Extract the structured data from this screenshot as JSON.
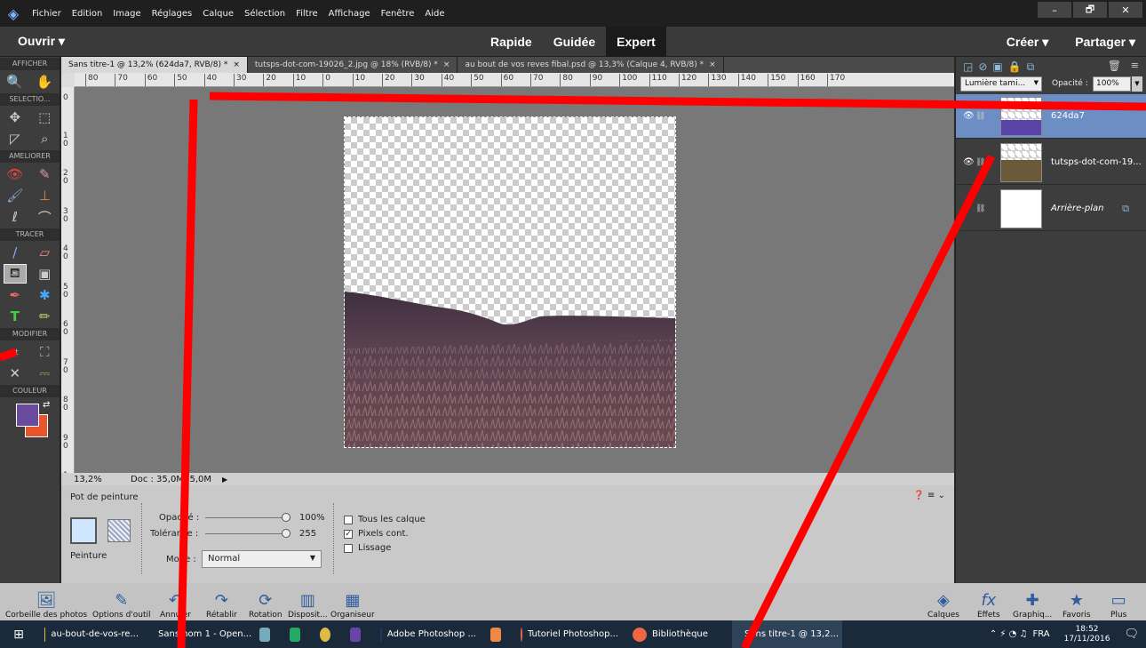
{
  "menu": [
    "Fichier",
    "Edition",
    "Image",
    "Réglages",
    "Calque",
    "Sélection",
    "Filtre",
    "Affichage",
    "Fenêtre",
    "Aide"
  ],
  "window_buttons": [
    "–",
    "🗗",
    "✕"
  ],
  "modebar": {
    "open_label": "Ouvrir",
    "open_arrow": "▾",
    "modes": [
      "Rapide",
      "Guidée",
      "Expert"
    ],
    "active_mode": "Expert",
    "create_label": "Créer ▾",
    "share_label": "Partager ▾"
  },
  "toolbox": {
    "sections": [
      "AFFICHER",
      "SELECTIO...",
      "AMELIORER",
      "TRACER",
      "MODIFIER",
      "COULEUR"
    ]
  },
  "tabs": [
    {
      "label": "Sans titre-1 @ 13,2% (624da7, RVB/8) *",
      "close": "×",
      "active": true
    },
    {
      "label": "tutsps-dot-com-19026_2.jpg @ 18% (RVB/8) *",
      "close": "×",
      "active": false
    },
    {
      "label": "au bout de vos reves fibal.psd @ 13,3% (Calque 4, RVB/8) *",
      "close": "×",
      "active": false
    }
  ],
  "ruler_h": [
    "80",
    "70",
    "60",
    "50",
    "40",
    "30",
    "20",
    "10",
    "0",
    "10",
    "20",
    "30",
    "40",
    "50",
    "60",
    "70",
    "80",
    "90",
    "100",
    "110",
    "120",
    "130",
    "140",
    "150",
    "160",
    "170"
  ],
  "ruler_v": [
    "0",
    "1 0",
    "2 0",
    "3 0",
    "4 0",
    "5 0",
    "6 0",
    "7 0",
    "8 0",
    "9 0",
    "1 0 0"
  ],
  "status": {
    "zoom": "13,2%",
    "doc": "Doc : 35,0M/ 5,0M",
    "arrow": "▶"
  },
  "options": {
    "tool_name": "Pot de peinture",
    "mode_label": "Peinture",
    "opacity_label": "Opacité :",
    "opacity_value": "100%",
    "tolerance_label": "Tolérance :",
    "tolerance_value": "255",
    "blend_label": "Mode :",
    "blend_value": "Normal",
    "check_all_layers": "Tous les calque",
    "check_contiguous": "Pixels cont.",
    "check_smooth": "Lissage",
    "help": "❓ ≡ ⌄"
  },
  "layers": {
    "blend_mode": "Lumière tami...",
    "opacity_label": "Opacité :",
    "opacity_value": "100%",
    "items": [
      {
        "name": "624da7",
        "active": true
      },
      {
        "name": "tutsps-dot-com-19...",
        "active": false
      },
      {
        "name": "Arrière-plan",
        "active": false
      }
    ]
  },
  "panelbar": {
    "left": [
      "Corbeille des photos",
      "Options d'outil",
      "Annuler",
      "Rétablir",
      "Rotation",
      "Disposit...",
      "Organiseur"
    ],
    "right": [
      "Calques",
      "Effets",
      "Graphiq...",
      "Favoris",
      "Plus"
    ]
  },
  "taskbar": {
    "items": [
      "au-bout-de-vos-re...",
      "Sans nom 1 - Open...",
      "Adobe Photoshop ...",
      "Tutoriel Photoshop...",
      "Bibliothèque",
      "Sans titre-1 @ 13,2..."
    ],
    "lang": "FRA",
    "time": "18:52",
    "date": "17/11/2016"
  },
  "colors": {
    "foreground": "#6a4a9c",
    "background": "#e8552a",
    "active_layer": "#6d8ec4",
    "annotation": "#ff0000"
  }
}
